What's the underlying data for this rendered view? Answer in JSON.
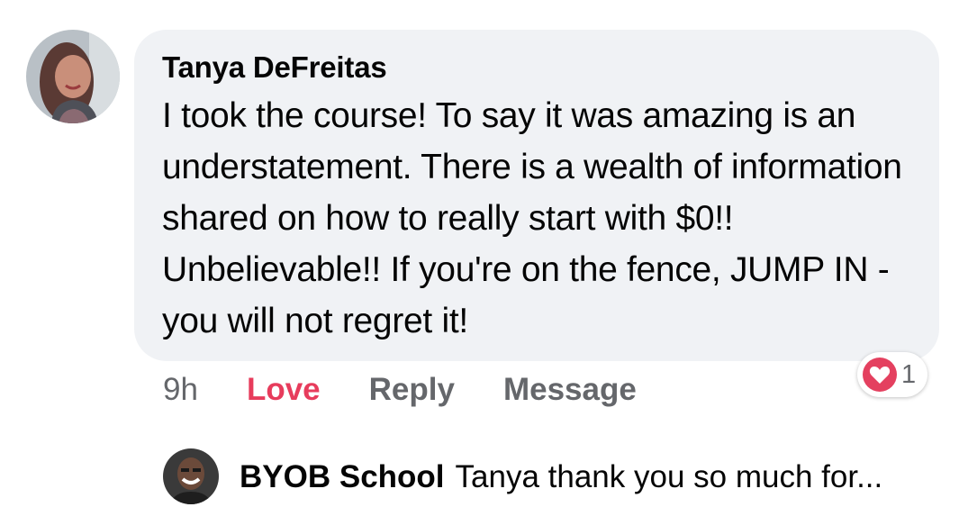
{
  "comment": {
    "author": "Tanya DeFreitas",
    "text": "I took the course! To say it was amazing is an understatement. There is a wealth of information shared on how to really start with $0!! Unbelievable!! If you're on the fence, JUMP IN - you will not regret it!"
  },
  "actions": {
    "time": "9h",
    "love_label": "Love",
    "reply_label": "Reply",
    "message_label": "Message"
  },
  "reactions": {
    "icon": "heart-icon",
    "count": "1"
  },
  "reply": {
    "author": "BYOB School",
    "preview": "Tanya thank you so much for..."
  },
  "colors": {
    "bubble_bg": "#f0f2f5",
    "love_active": "#e73c5c",
    "secondary_text": "#65676b",
    "heart_badge": "#e4405f"
  }
}
